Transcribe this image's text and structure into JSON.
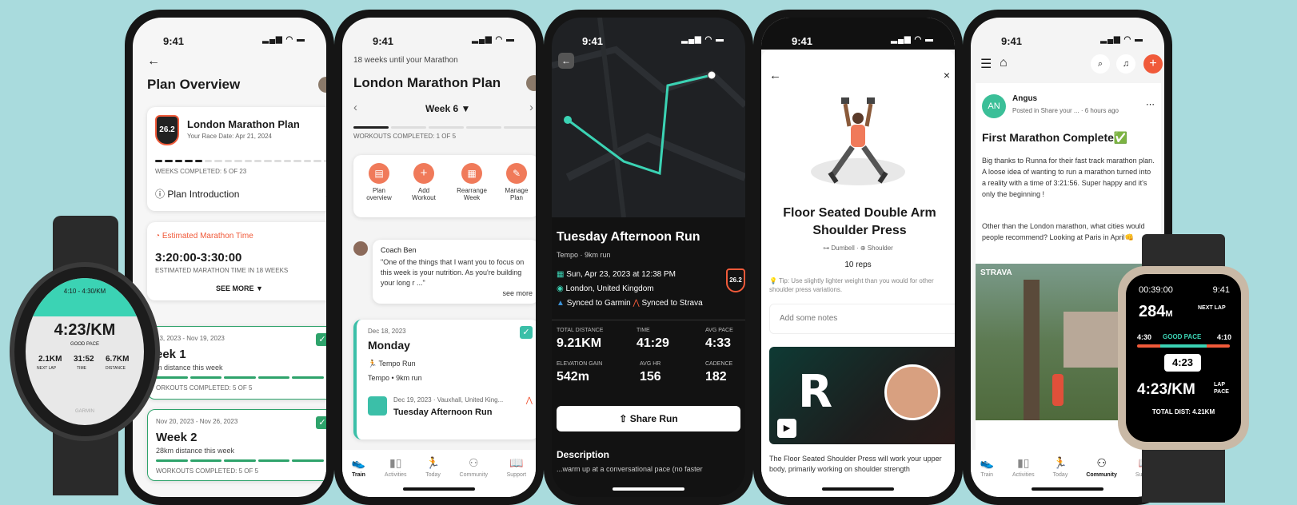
{
  "status_time": "9:41",
  "p1": {
    "title": "Plan Overview",
    "badge": "26.2",
    "plan_name": "London Marathon Plan",
    "race_date": "Your Race Date: Apr 21, 2024",
    "weeks_completed": "WEEKS COMPLETED: 5 OF 23",
    "plan_intro": "Plan Introduction",
    "est_label": "Estimated Marathon Time",
    "est_value": "3:20:00-3:30:00",
    "est_sub": "ESTIMATED MARATHON TIME IN 18 WEEKS",
    "see_more": "SEE MORE",
    "weeks": [
      {
        "dates": "13, 2023 - Nov 19, 2023",
        "name": "eek 1",
        "desc": "m distance this week",
        "done": "ORKOUTS COMPLETED: 5 OF 5"
      },
      {
        "dates": "Nov 20, 2023 - Nov 26, 2023",
        "name": "Week 2",
        "desc": "28km distance this week",
        "done": "WORKOUTS COMPLETED: 5 OF 5"
      }
    ]
  },
  "p2": {
    "countdown": "18 weeks until your Marathon",
    "title": "London Marathon Plan",
    "week": "Week 6",
    "workouts_completed": "WORKOUTS COMPLETED: 1 OF 5",
    "actions": [
      {
        "label": "Plan overview"
      },
      {
        "label": "Add Workout"
      },
      {
        "label": "Rearrange Week"
      },
      {
        "label": "Manage Plan"
      }
    ],
    "coach": "Coach Ben",
    "coach_msg": "\"One of the things that I want you to focus on this week is your nutrition. As you're building your long r ...\"",
    "see_more": "see more",
    "day_date": "Dec 18, 2023",
    "day_name": "Monday",
    "workout": "Tempo Run",
    "workout_sub": "Tempo • 9km run",
    "activity_meta": "Dec 19, 2023 · Vauxhall, United King...",
    "activity_name": "Tuesday Afternoon Run"
  },
  "nav": [
    "Train",
    "Activities",
    "Today",
    "Community",
    "Support"
  ],
  "p3": {
    "title": "Tuesday Afternoon Run",
    "sub": "Tempo · 9km run",
    "date": "Sun, Apr 23, 2023 at 12:38 PM",
    "location": "London, United Kingdom",
    "garmin": "Synced to Garmin",
    "strava": "Synced to Strava",
    "badge": "26.2",
    "stats": [
      {
        "label": "TOTAL DISTANCE",
        "value": "9.21KM"
      },
      {
        "label": "TIME",
        "value": "41:29"
      },
      {
        "label": "AVG PACE",
        "value": "4:33"
      },
      {
        "label": "ELEVATION GAIN",
        "value": "542m"
      },
      {
        "label": "AVG HR",
        "value": "156"
      },
      {
        "label": "CADENCE",
        "value": "182"
      }
    ],
    "share": "Share Run",
    "description": "Description",
    "desc_text": "...warm up at a conversational pace (no faster"
  },
  "p4": {
    "title": "Floor Seated Double Arm Shoulder Press",
    "equip1": "Dumbell",
    "equip2": "Shoulder",
    "reps": "10 reps",
    "tip": "Tip: Use slightly lighter weight than you would for other shoulder press variations.",
    "notes_placeholder": "Add some notes",
    "body": "The Floor Seated Shoulder Press will work your upper body, primarily working on shoulder strength"
  },
  "p5": {
    "avatar": "AN",
    "author": "Angus",
    "posted": "Posted in Share your ... · 6 hours ago",
    "title": "First Marathon Complete✅",
    "body1": "Big thanks to Runna for their fast track marathon plan. A loose idea of wanting to run a marathon turned into a reality with a time of 3:21:56. Super happy and it's only the beginning !",
    "body2": "Other than the London marathon, what cities would people recommend? Looking at Paris in April👊",
    "strava": "STRAVA"
  },
  "watch1": {
    "range": "4:10 - 4:30/KM",
    "pace": "4:23/KM",
    "status": "GOOD PACE",
    "vals": [
      "2.1KM",
      "31:52",
      "6.7KM"
    ],
    "labels": [
      "NEXT LAP",
      "TIME",
      "DISTANCE"
    ],
    "brand": "GARMIN"
  },
  "watch2": {
    "time": "00:39:00",
    "clock": "9:41",
    "lap": "284",
    "lap_unit": "M",
    "next": "NEXT LAP",
    "lo": "4:30",
    "status": "GOOD PACE",
    "hi": "4:10",
    "cur": "4:23",
    "pace": "4:23/KM",
    "lap_pace": "LAP PACE",
    "total": "TOTAL DIST: 4.21KM"
  },
  "colors": {
    "accent": "#f05a3a",
    "green": "#2ea36b",
    "teal": "#3bd3b4",
    "bg": "#a9dbdd"
  }
}
